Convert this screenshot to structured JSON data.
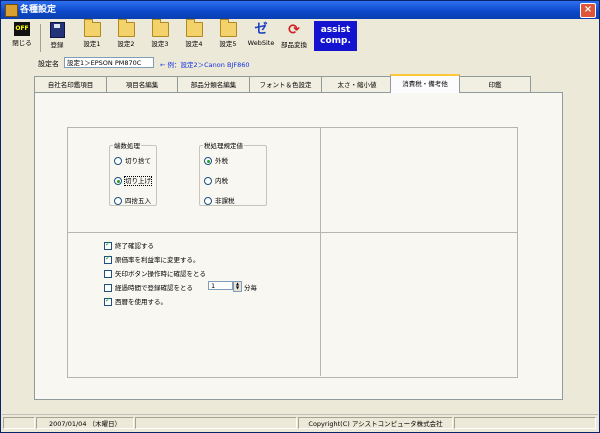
{
  "window": {
    "title": "各種設定",
    "close_glyph": "×"
  },
  "toolbar": {
    "close_label": "閉じる",
    "close_icon_text": "OFF",
    "register_label": "登録",
    "settings": [
      "設定1",
      "設定2",
      "設定3",
      "設定4",
      "設定5"
    ],
    "website_label": "WebSite",
    "website_glyph": "ゼ",
    "parts_convert_label": "部品変換",
    "convert_glyph": "⟳",
    "assist_line1": "assist",
    "assist_line2": "comp."
  },
  "setting_name": {
    "label": "設定名",
    "value": "設定1＞EPSON PM870C",
    "example": "← 例：設定2＞Canon BJF860"
  },
  "tabs": [
    "自社名印鑑項目",
    "項目名編集",
    "部品分類名編集",
    "フォント＆色設定",
    "太さ・縮小値",
    "消費税・備考他",
    "印鑑"
  ],
  "active_tab_index": 5,
  "rounding": {
    "title": "端数処理",
    "options": [
      "切り捨て",
      "切り上げ",
      "四捨五入"
    ],
    "selected": 1
  },
  "tax": {
    "title": "税処理規定値",
    "options": [
      "外税",
      "内税",
      "非課税"
    ],
    "selected": 0
  },
  "checkboxes": [
    {
      "label": "終了確認する",
      "checked": true
    },
    {
      "label": "原価率を利益率に変更する。",
      "checked": true
    },
    {
      "label": "矢印ボタン操作時に確認をとる",
      "checked": false
    },
    {
      "label": "経過時間で登録確認をとる",
      "checked": false
    },
    {
      "label": "西暦を使用する。",
      "checked": true
    }
  ],
  "elapsed": {
    "value": "1",
    "unit": "分毎",
    "spin_up": "▲",
    "spin_down": "▼"
  },
  "status": {
    "date": "2007/01/04 （木曜日）",
    "copyright": "Copyright(C) アシストコンピュータ株式会社"
  },
  "colors": {
    "title_bar": "#0a48c8",
    "assist_bg": "#1313d0",
    "link": "#1030e0",
    "active_tab_accent": "#ffc83c"
  },
  "icons": [
    "app-icon",
    "close-window-icon",
    "off-icon",
    "save-disk-icon",
    "folder-icon",
    "website-icon",
    "convert-arrows-icon"
  ]
}
